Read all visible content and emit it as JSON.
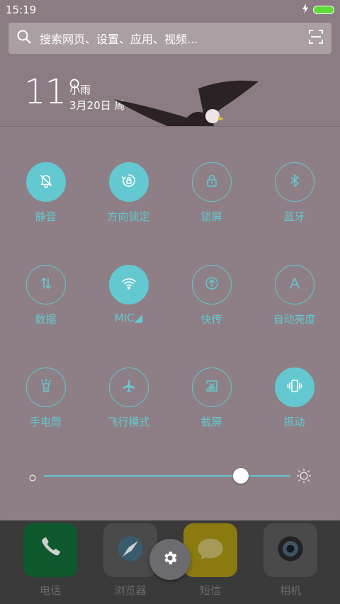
{
  "status_bar": {
    "time": "15:19"
  },
  "search": {
    "placeholder": "搜索网页、设置、应用、视频..."
  },
  "weather": {
    "temp": "11°",
    "condition": "小雨",
    "date": "3月20日 周一"
  },
  "toggles": [
    {
      "label": "静音",
      "icon": "mute-bell-icon",
      "on": true
    },
    {
      "label": "方向锁定",
      "icon": "rotation-lock-icon",
      "on": true
    },
    {
      "label": "锁屏",
      "icon": "lock-icon",
      "on": false
    },
    {
      "label": "蓝牙",
      "icon": "bluetooth-icon",
      "on": false
    },
    {
      "label": "数据",
      "icon": "mobile-data-icon",
      "on": false
    },
    {
      "label": "MIC◢",
      "icon": "wifi-icon",
      "on": true
    },
    {
      "label": "快传",
      "icon": "quick-transfer-icon",
      "on": false
    },
    {
      "label": "自动亮度",
      "icon": "auto-brightness-icon",
      "on": false
    },
    {
      "label": "手电筒",
      "icon": "flashlight-icon",
      "on": false
    },
    {
      "label": "飞行模式",
      "icon": "airplane-icon",
      "on": false
    },
    {
      "label": "截屏",
      "icon": "screenshot-icon",
      "on": false
    },
    {
      "label": "振动",
      "icon": "vibrate-icon",
      "on": true
    }
  ],
  "brightness": {
    "level": 0.8
  },
  "dock": [
    {
      "label": "电话",
      "icon": "phone-icon",
      "color": "#0e5a2e"
    },
    {
      "label": "浏览器",
      "icon": "compass-icon",
      "color": "#4a4a4a"
    },
    {
      "label": "短信",
      "icon": "message-icon",
      "color": "#8a7a10"
    },
    {
      "label": "相机",
      "icon": "camera-icon",
      "color": "#4a4a4a"
    }
  ],
  "colors": {
    "accent": "#63c8cf",
    "battery": "#5fdc3a",
    "panel": "#8e7f86"
  }
}
